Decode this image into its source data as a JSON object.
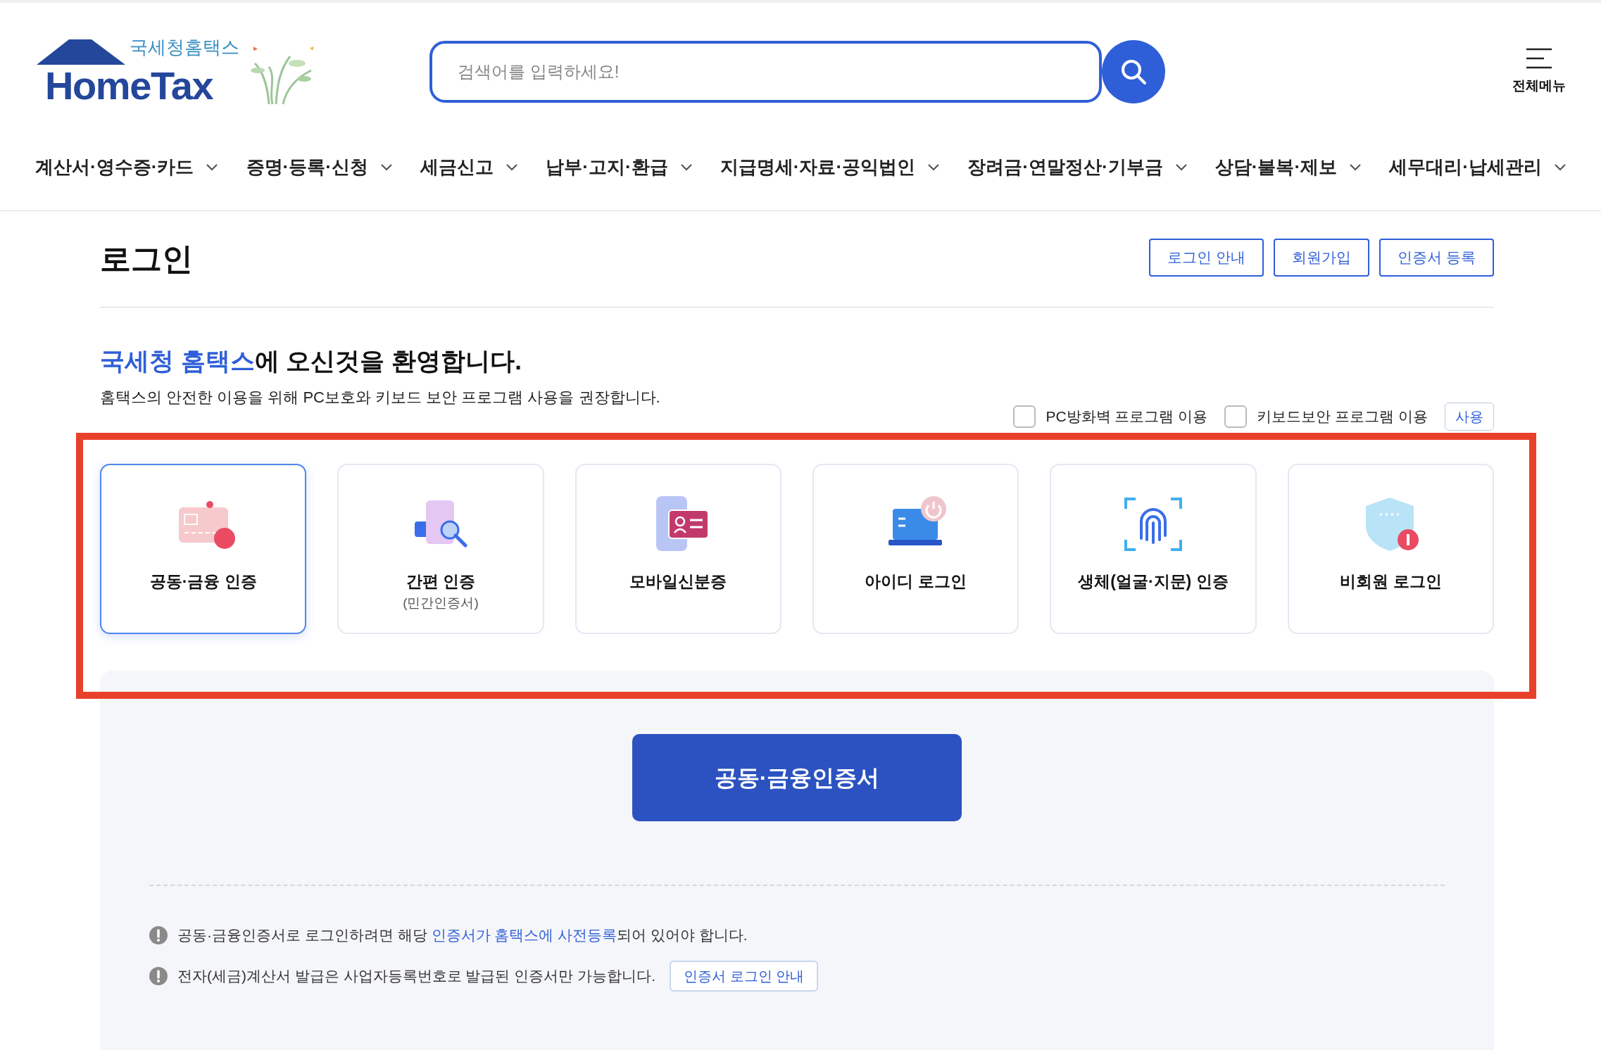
{
  "header": {
    "logo_caption": "국세청홈택스",
    "logo_text": "HomeTax",
    "search": {
      "placeholder": "검색어를 입력하세요!"
    },
    "menu_label": "전체메뉴"
  },
  "nav": [
    "계산서·영수증·카드",
    "증명·등록·신청",
    "세금신고",
    "납부·고지·환급",
    "지급명세·자료·공익법인",
    "장려금·연말정산·기부금",
    "상담·불복·제보",
    "세무대리·납세관리"
  ],
  "page": {
    "title": "로그인",
    "buttons": [
      "로그인 안내",
      "회원가입",
      "인증서 등록"
    ]
  },
  "welcome": {
    "heading_highlight": "국세청 홈택스",
    "heading_rest": "에 오신것을 환영합니다.",
    "subtitle": "홈택스의 안전한 이용을 위해 PC보호와 키보드 보안 프로그램 사용을 권장합니다."
  },
  "options": [
    {
      "label": "PC방화벽 프로그램 이용",
      "checked": false
    },
    {
      "label": "키보드보안 프로그램 이용",
      "checked": false
    }
  ],
  "options_button": "사용",
  "methods": [
    {
      "kind": "card",
      "label": "공동·금융 인증",
      "selected": true
    },
    {
      "kind": "phone-search",
      "label": "간편 인증",
      "sublabel": "(민간인증서)",
      "selected": false
    },
    {
      "kind": "id-card",
      "label": "모바일신분증",
      "selected": false
    },
    {
      "kind": "laptop",
      "label": "아이디 로그인",
      "selected": false
    },
    {
      "kind": "fingerprint",
      "label": "생체(얼굴·지문) 인증",
      "selected": false
    },
    {
      "kind": "shield",
      "label": "비회원 로그인",
      "selected": false
    }
  ],
  "primary_button": "공동·금융인증서",
  "notices": [
    {
      "text": "공동·금융인증서로 로그인하려면 해당 ",
      "link": "인증서가 홈택스에 사전등록",
      "after": "되어 있어야 합니다."
    },
    {
      "text": "전자(세금)계산서 발급은 사업자등록번호로 발급된 인증서만 가능합니다.",
      "button": "인증서 로그인 안내"
    }
  ]
}
